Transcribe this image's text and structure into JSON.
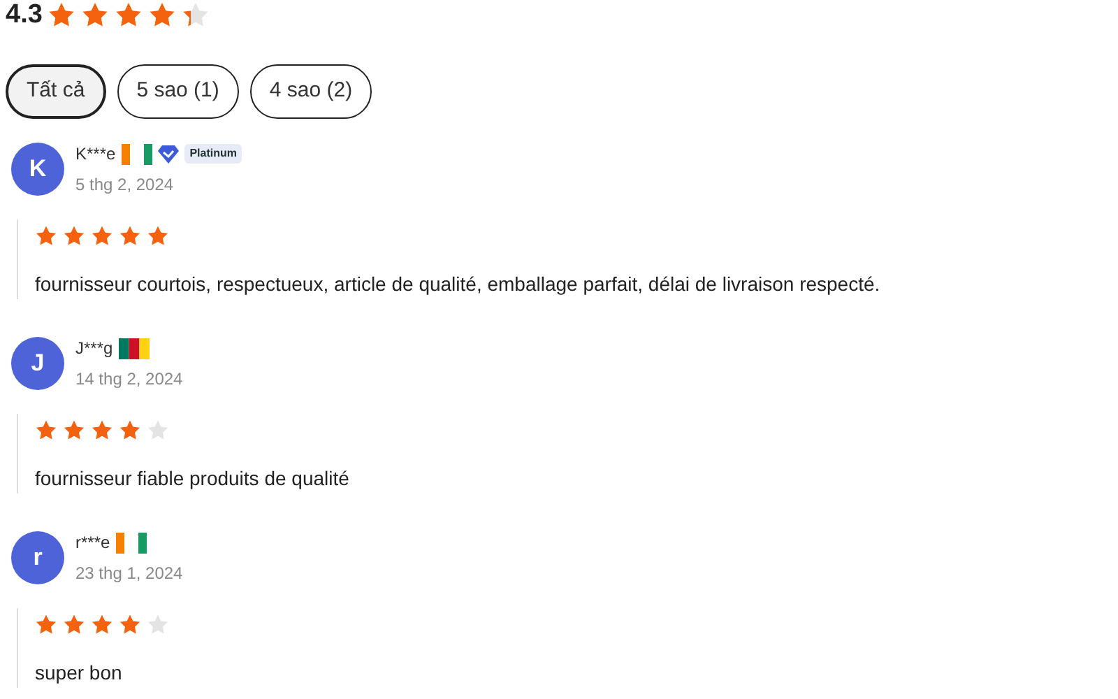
{
  "summary": {
    "score": "4.3",
    "stars": 4.3
  },
  "filters": [
    {
      "label": "Tất cả",
      "selected": true
    },
    {
      "label": "5 sao (1)",
      "selected": false
    },
    {
      "label": "4 sao (2)",
      "selected": false
    }
  ],
  "reviews": [
    {
      "initial": "K",
      "name": "K***e",
      "kind": "ivorian",
      "badge": "Platinum",
      "date": "5 thg 2, 2024",
      "stars": 5,
      "text": "fournisseur courtois, respectueux, article de qualité, emballage parfait, délai de livraison respecté."
    },
    {
      "initial": "J",
      "name": "J***g",
      "kind": "cameroonian",
      "date": "14 thg 2, 2024",
      "stars": 4,
      "text": "fournisseur fiable produits de qualité"
    },
    {
      "initial": "r",
      "name": "r***e",
      "kind": "ivorian",
      "date": "23 thg 1, 2024",
      "stars": 4,
      "text": "super bon"
    }
  ]
}
